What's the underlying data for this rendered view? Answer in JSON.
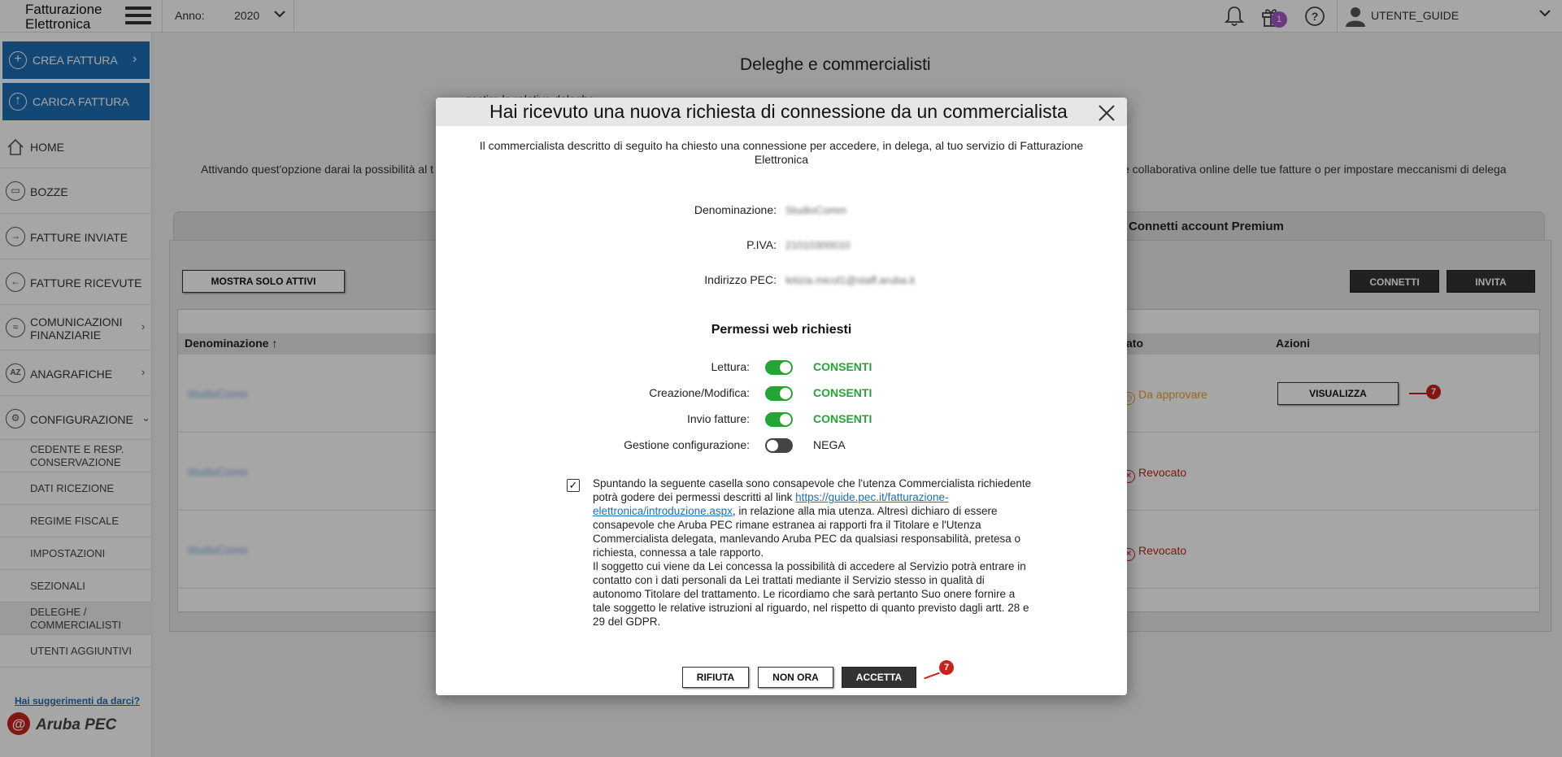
{
  "app": {
    "logo_line1": "Fatturazione",
    "logo_line2": "Elettronica",
    "year_label": "Anno:",
    "year_value": "2020",
    "gift_count": "1",
    "user_name": "UTENTE_GUIDE"
  },
  "sidebar": {
    "create_invoice": "CREA FATTURA",
    "upload_invoice": "CARICA FATTURA",
    "items": [
      {
        "label": "HOME",
        "icon": "home-icon"
      },
      {
        "label": "BOZZE",
        "icon": "drafts-icon"
      },
      {
        "label": "FATTURE INVIATE",
        "icon": "sent-icon"
      },
      {
        "label": "FATTURE RICEVUTE",
        "icon": "received-icon"
      },
      {
        "label": "COMUNICAZIONI FINANZIARIE",
        "icon": "finance-icon"
      },
      {
        "label": "ANAGRAFICHE",
        "icon": "registry-icon"
      },
      {
        "label": "CONFIGURAZIONE",
        "icon": "gear-icon"
      }
    ],
    "subitems": [
      "CEDENTE E RESP. CONSERVAZIONE",
      "DATI RICEZIONE",
      "REGIME FISCALE",
      "IMPOSTAZIONI",
      "SEZIONALI",
      "DELEGHE / COMMERCIALISTI",
      "UTENTI AGGIUNTIVI"
    ],
    "suggest": "Hai suggerimenti da darci?",
    "brand": "Aruba PEC"
  },
  "main": {
    "title": "Deleghe e commercialisti",
    "desc_line1": "... gestire le relative deleghe.",
    "desc_line2_left": "Attivando quest'opzione darai la possibilità al t",
    "desc_line2_right": "e collaborativa online delle tue fatture o per impostare meccanismi di delega",
    "tab_premium": "Connetti account Premium",
    "show_active": "MOSTRA SOLO ATTIVI",
    "connect": "CONNETTI",
    "invite": "INVITA",
    "col_name": "Denominazione",
    "col_state": "ato",
    "col_actions": "Azioni",
    "rows": [
      {
        "name": "StudioComm",
        "status": "Da approvare",
        "action": "VISUALIZZA"
      },
      {
        "name": "StudioComm",
        "status": "Revocato"
      },
      {
        "name": "StudioComm",
        "status": "Revocato"
      }
    ],
    "callout": "7"
  },
  "modal": {
    "title": "Hai ricevuto una nuova richiesta di connessione da un commercialista",
    "intro": "Il commercialista descritto di seguito ha chiesto una connessione per accedere, in delega, al tuo servizio di Fatturazione Elettronica",
    "denominazione_label": "Denominazione:",
    "denominazione_value": "StudioComm",
    "piva_label": "P.IVA:",
    "piva_value": "21010300010",
    "pec_label": "Indirizzo PEC:",
    "pec_value": "letizia.micol1@staff.aruba.it",
    "perm_title": "Permessi web richiesti",
    "permissions": [
      {
        "label": "Lettura:",
        "value": "CONSENTI",
        "on": true
      },
      {
        "label": "Creazione/Modifica:",
        "value": "CONSENTI",
        "on": true
      },
      {
        "label": "Invio fatture:",
        "value": "CONSENTI",
        "on": true
      },
      {
        "label": "Gestione configurazione:",
        "value": "NEGA",
        "on": false
      }
    ],
    "consent_part1": "Spuntando la seguente casella sono consapevole che l'utenza Commercialista richiedente potrà godere dei permessi descritti al link ",
    "consent_link": "https://guide.pec.it/fatturazione-elettronica/introduzione.aspx",
    "consent_part2": ", in relazione alla mia utenza. Altresì dichiaro di essere consapevole che Aruba PEC rimane estranea ai rapporti fra il Titolare e l'Utenza Commercialista delegata, manlevando Aruba PEC da qualsiasi responsabilità, pretesa o richiesta, connessa a tale rapporto.",
    "consent_part3": "Il soggetto cui viene da Lei concessa la possibilità di accedere al Servizio potrà entrare in contatto con i dati personali da Lei trattati mediante il Servizio stesso in qualità di autonomo Titolare del trattamento. Le ricordiamo che sarà pertanto Suo onere fornire a tale soggetto le relative istruzioni al riguardo, nel rispetto di quanto previsto dagli artt. 28 e 29 del GDPR.",
    "refuse": "RIFIUTA",
    "not_now": "NON ORA",
    "accept": "ACCETTA",
    "callout": "7"
  },
  "colors": {
    "accent_blue": "#1c6eb5",
    "allow_green": "#23a633",
    "pending_orange": "#e8a030",
    "revoked_red": "#c9211e"
  }
}
